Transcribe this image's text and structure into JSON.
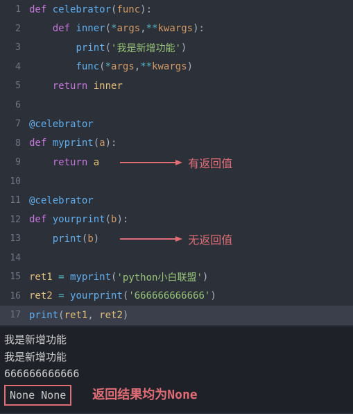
{
  "lines": [
    {
      "num": "1",
      "indent": "",
      "tokens": [
        [
          "kw",
          "def "
        ],
        [
          "fn",
          "celebrator"
        ],
        [
          "punct",
          "("
        ],
        [
          "param",
          "func"
        ],
        [
          "punct",
          "):"
        ]
      ]
    },
    {
      "num": "2",
      "indent": "    ",
      "tokens": [
        [
          "kw",
          "def "
        ],
        [
          "fn",
          "inner"
        ],
        [
          "punct",
          "("
        ],
        [
          "op",
          "*"
        ],
        [
          "param",
          "args"
        ],
        [
          "punct",
          ","
        ],
        [
          "op",
          "**"
        ],
        [
          "param",
          "kwargs"
        ],
        [
          "punct",
          "):"
        ]
      ]
    },
    {
      "num": "3",
      "indent": "        ",
      "tokens": [
        [
          "fn",
          "print"
        ],
        [
          "punct",
          "("
        ],
        [
          "str",
          "'我是新增功能'"
        ],
        [
          "punct",
          ")"
        ]
      ]
    },
    {
      "num": "4",
      "indent": "        ",
      "tokens": [
        [
          "fn",
          "func"
        ],
        [
          "punct",
          "("
        ],
        [
          "op",
          "*"
        ],
        [
          "param",
          "args"
        ],
        [
          "punct",
          ","
        ],
        [
          "op",
          "**"
        ],
        [
          "param",
          "kwargs"
        ],
        [
          "punct",
          ")"
        ]
      ]
    },
    {
      "num": "5",
      "indent": "    ",
      "tokens": [
        [
          "kw",
          "return "
        ],
        [
          "fname",
          "inner"
        ]
      ]
    },
    {
      "num": "6",
      "indent": "",
      "tokens": []
    },
    {
      "num": "7",
      "indent": "",
      "tokens": [
        [
          "dec",
          "@celebrator"
        ]
      ]
    },
    {
      "num": "8",
      "indent": "",
      "tokens": [
        [
          "kw",
          "def "
        ],
        [
          "fn",
          "myprint"
        ],
        [
          "punct",
          "("
        ],
        [
          "param",
          "a"
        ],
        [
          "punct",
          "):"
        ]
      ]
    },
    {
      "num": "9",
      "indent": "    ",
      "tokens": [
        [
          "kw",
          "return "
        ],
        [
          "fname",
          "a"
        ]
      ],
      "arrow": true,
      "note": "有返回值"
    },
    {
      "num": "10",
      "indent": "",
      "tokens": []
    },
    {
      "num": "11",
      "indent": "",
      "tokens": [
        [
          "dec",
          "@celebrator"
        ]
      ]
    },
    {
      "num": "12",
      "indent": "",
      "tokens": [
        [
          "kw",
          "def "
        ],
        [
          "fn",
          "yourprint"
        ],
        [
          "punct",
          "("
        ],
        [
          "param",
          "b"
        ],
        [
          "punct",
          "):"
        ]
      ]
    },
    {
      "num": "13",
      "indent": "    ",
      "tokens": [
        [
          "fn",
          "print"
        ],
        [
          "punct",
          "("
        ],
        [
          "param",
          "b"
        ],
        [
          "punct",
          ")"
        ]
      ],
      "arrow": true,
      "note": "无返回值"
    },
    {
      "num": "14",
      "indent": "",
      "tokens": []
    },
    {
      "num": "15",
      "indent": "",
      "tokens": [
        [
          "fname",
          "ret1 "
        ],
        [
          "op",
          "= "
        ],
        [
          "fn",
          "myprint"
        ],
        [
          "punct",
          "("
        ],
        [
          "str",
          "'python小白联盟'"
        ],
        [
          "punct",
          ")"
        ]
      ]
    },
    {
      "num": "16",
      "indent": "",
      "tokens": [
        [
          "fname",
          "ret2 "
        ],
        [
          "op",
          "= "
        ],
        [
          "fn",
          "yourprint"
        ],
        [
          "punct",
          "("
        ],
        [
          "str",
          "'666666666666'"
        ],
        [
          "punct",
          ")"
        ]
      ]
    },
    {
      "num": "17",
      "indent": "",
      "tokens": [
        [
          "fn",
          "print"
        ],
        [
          "punct",
          "("
        ],
        [
          "fname",
          "ret1"
        ],
        [
          "punct",
          ", "
        ],
        [
          "fname",
          "ret2"
        ],
        [
          "punct",
          ")"
        ]
      ],
      "hl": true
    }
  ],
  "output": {
    "lines": [
      "我是新增功能",
      "我是新增功能",
      "666666666666"
    ],
    "none_result": "None None",
    "result_note": "返回结果均为None"
  }
}
